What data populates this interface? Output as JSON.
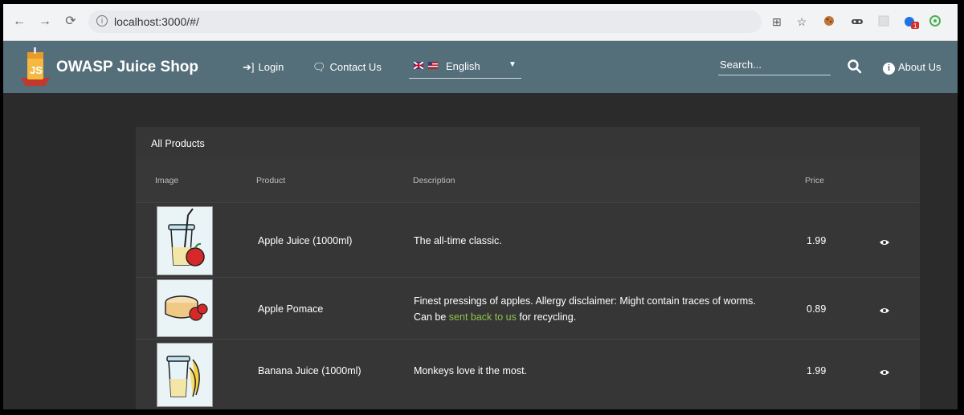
{
  "browser": {
    "url": "localhost:3000/#/",
    "ext_badge": "1"
  },
  "toolbar": {
    "brand": "OWASP Juice Shop",
    "login": "Login",
    "contact": "Contact Us",
    "language": "English",
    "search_placeholder": "Search...",
    "about": "About Us",
    "colors": {
      "toolbar": "#546e7a",
      "link": "#8bc34a"
    }
  },
  "products": {
    "title": "All Products",
    "headers": {
      "image": "Image",
      "product": "Product",
      "description": "Description",
      "price": "Price"
    },
    "rows": [
      {
        "name": "Apple Juice (1000ml)",
        "description": "The all-time classic.",
        "price": "1.99",
        "icon": "apple-juice-icon"
      },
      {
        "name": "Apple Pomace",
        "description_line1": "Finest pressings of apples. Allergy disclaimer: Might contain traces of worms.",
        "description_pre": "Can be",
        "description_link": "sent back to us",
        "description_post": "for recycling.",
        "price": "0.89",
        "icon": "apple-pomace-icon"
      },
      {
        "name": "Banana Juice (1000ml)",
        "description": "Monkeys love it the most.",
        "price": "1.99",
        "icon": "banana-juice-icon"
      }
    ]
  }
}
